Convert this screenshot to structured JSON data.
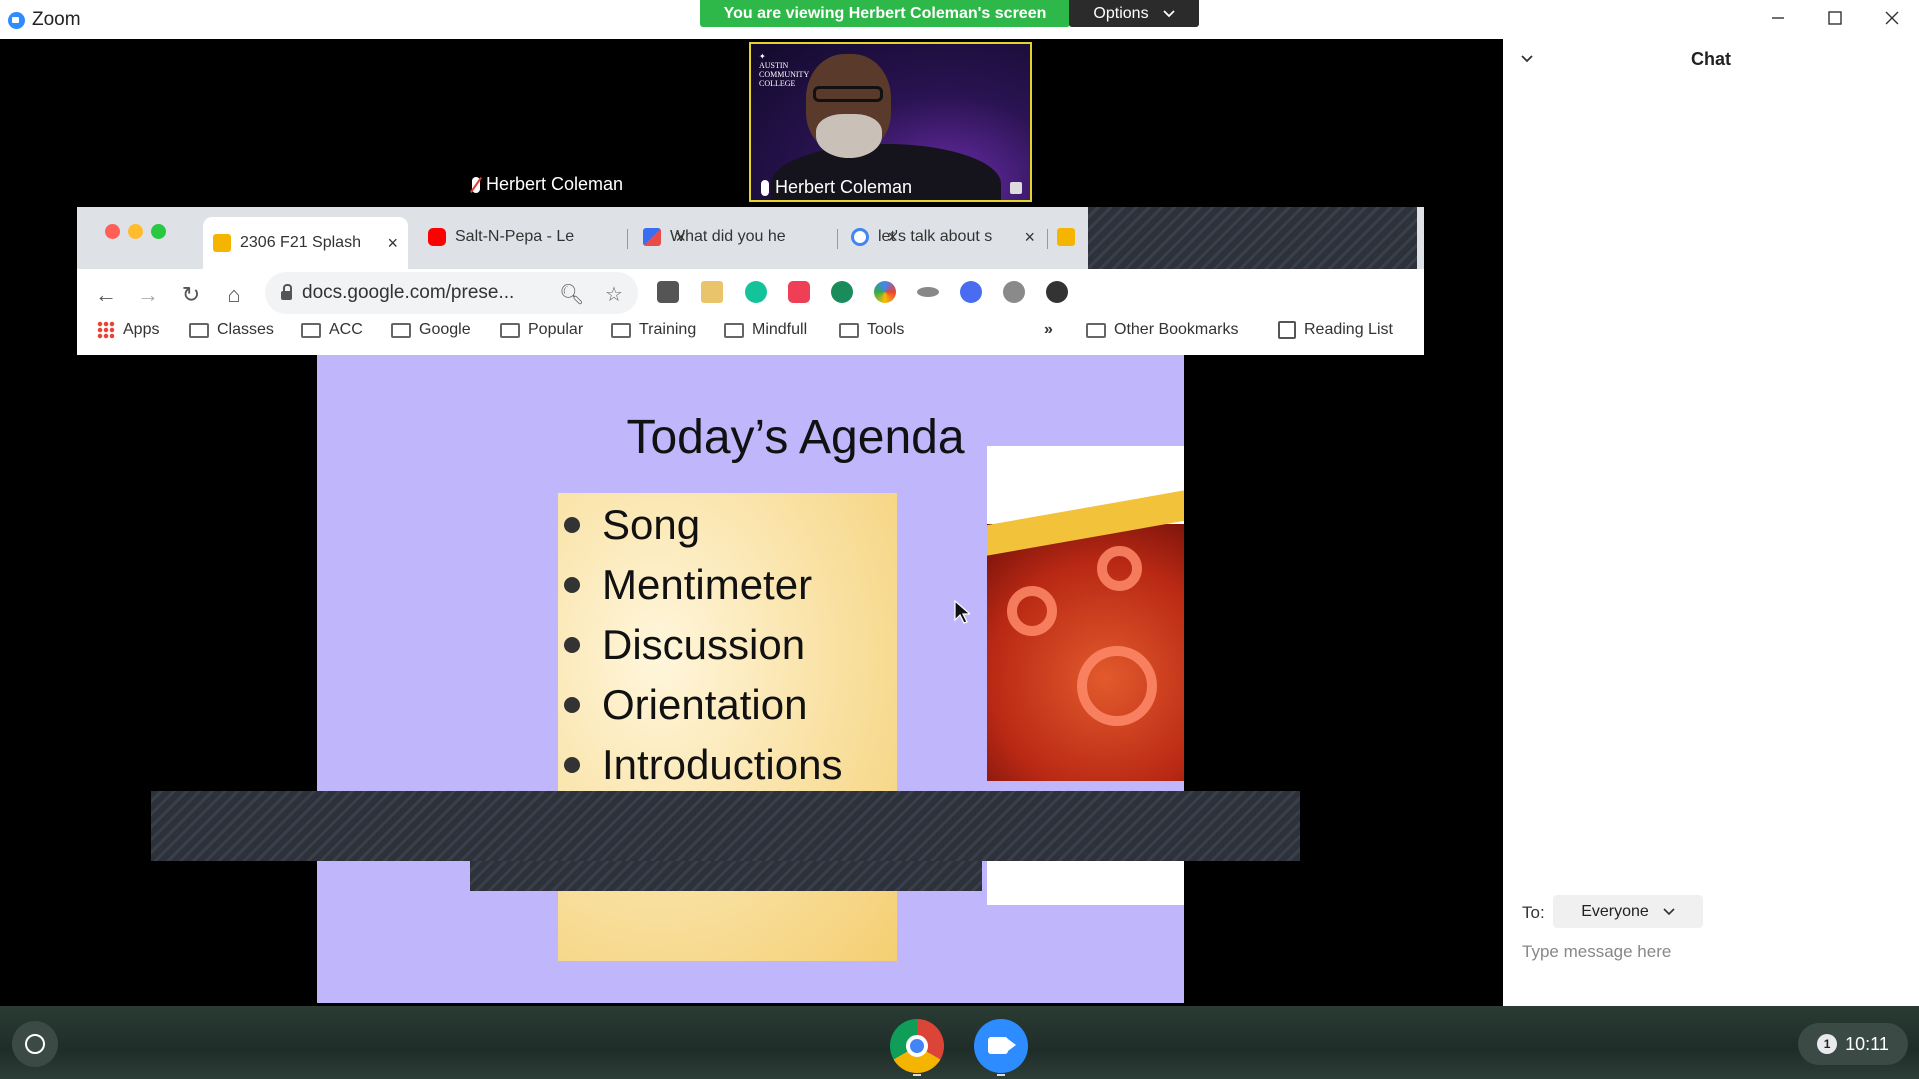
{
  "window": {
    "app_name": "Zoom"
  },
  "banner": {
    "viewing_text": "You are viewing Herbert Coleman's screen",
    "options_label": "Options"
  },
  "participants": {
    "speaker_name": "Herbert Coleman",
    "video_name": "Herbert Coleman"
  },
  "browser": {
    "tabs": [
      {
        "label": "2306 F21 Splash"
      },
      {
        "label": "Salt-N-Pepa - Le"
      },
      {
        "label": "What did you he"
      },
      {
        "label": "let's talk about s"
      }
    ],
    "url": "docs.google.com/prese...",
    "bookmarks": [
      "Apps",
      "Classes",
      "ACC",
      "Google",
      "Popular",
      "Training",
      "Mindfull",
      "Tools"
    ],
    "other_bookmarks": "Other Bookmarks",
    "reading_list": "Reading List",
    "overflow": "»"
  },
  "slide": {
    "title": "Today’s Agenda",
    "items": [
      "Song",
      "Mentimeter",
      "Discussion",
      "Orientation",
      "Introductions"
    ]
  },
  "chat": {
    "title": "Chat",
    "to_label": "To:",
    "recipient": "Everyone",
    "placeholder": "Type message here"
  },
  "shelf": {
    "time": "10:11",
    "notification_count": "1"
  },
  "colors": {
    "banner_green": "#2fb84a",
    "slide_bg": "#c0b6fc",
    "zoom_blue": "#2d8cff"
  }
}
